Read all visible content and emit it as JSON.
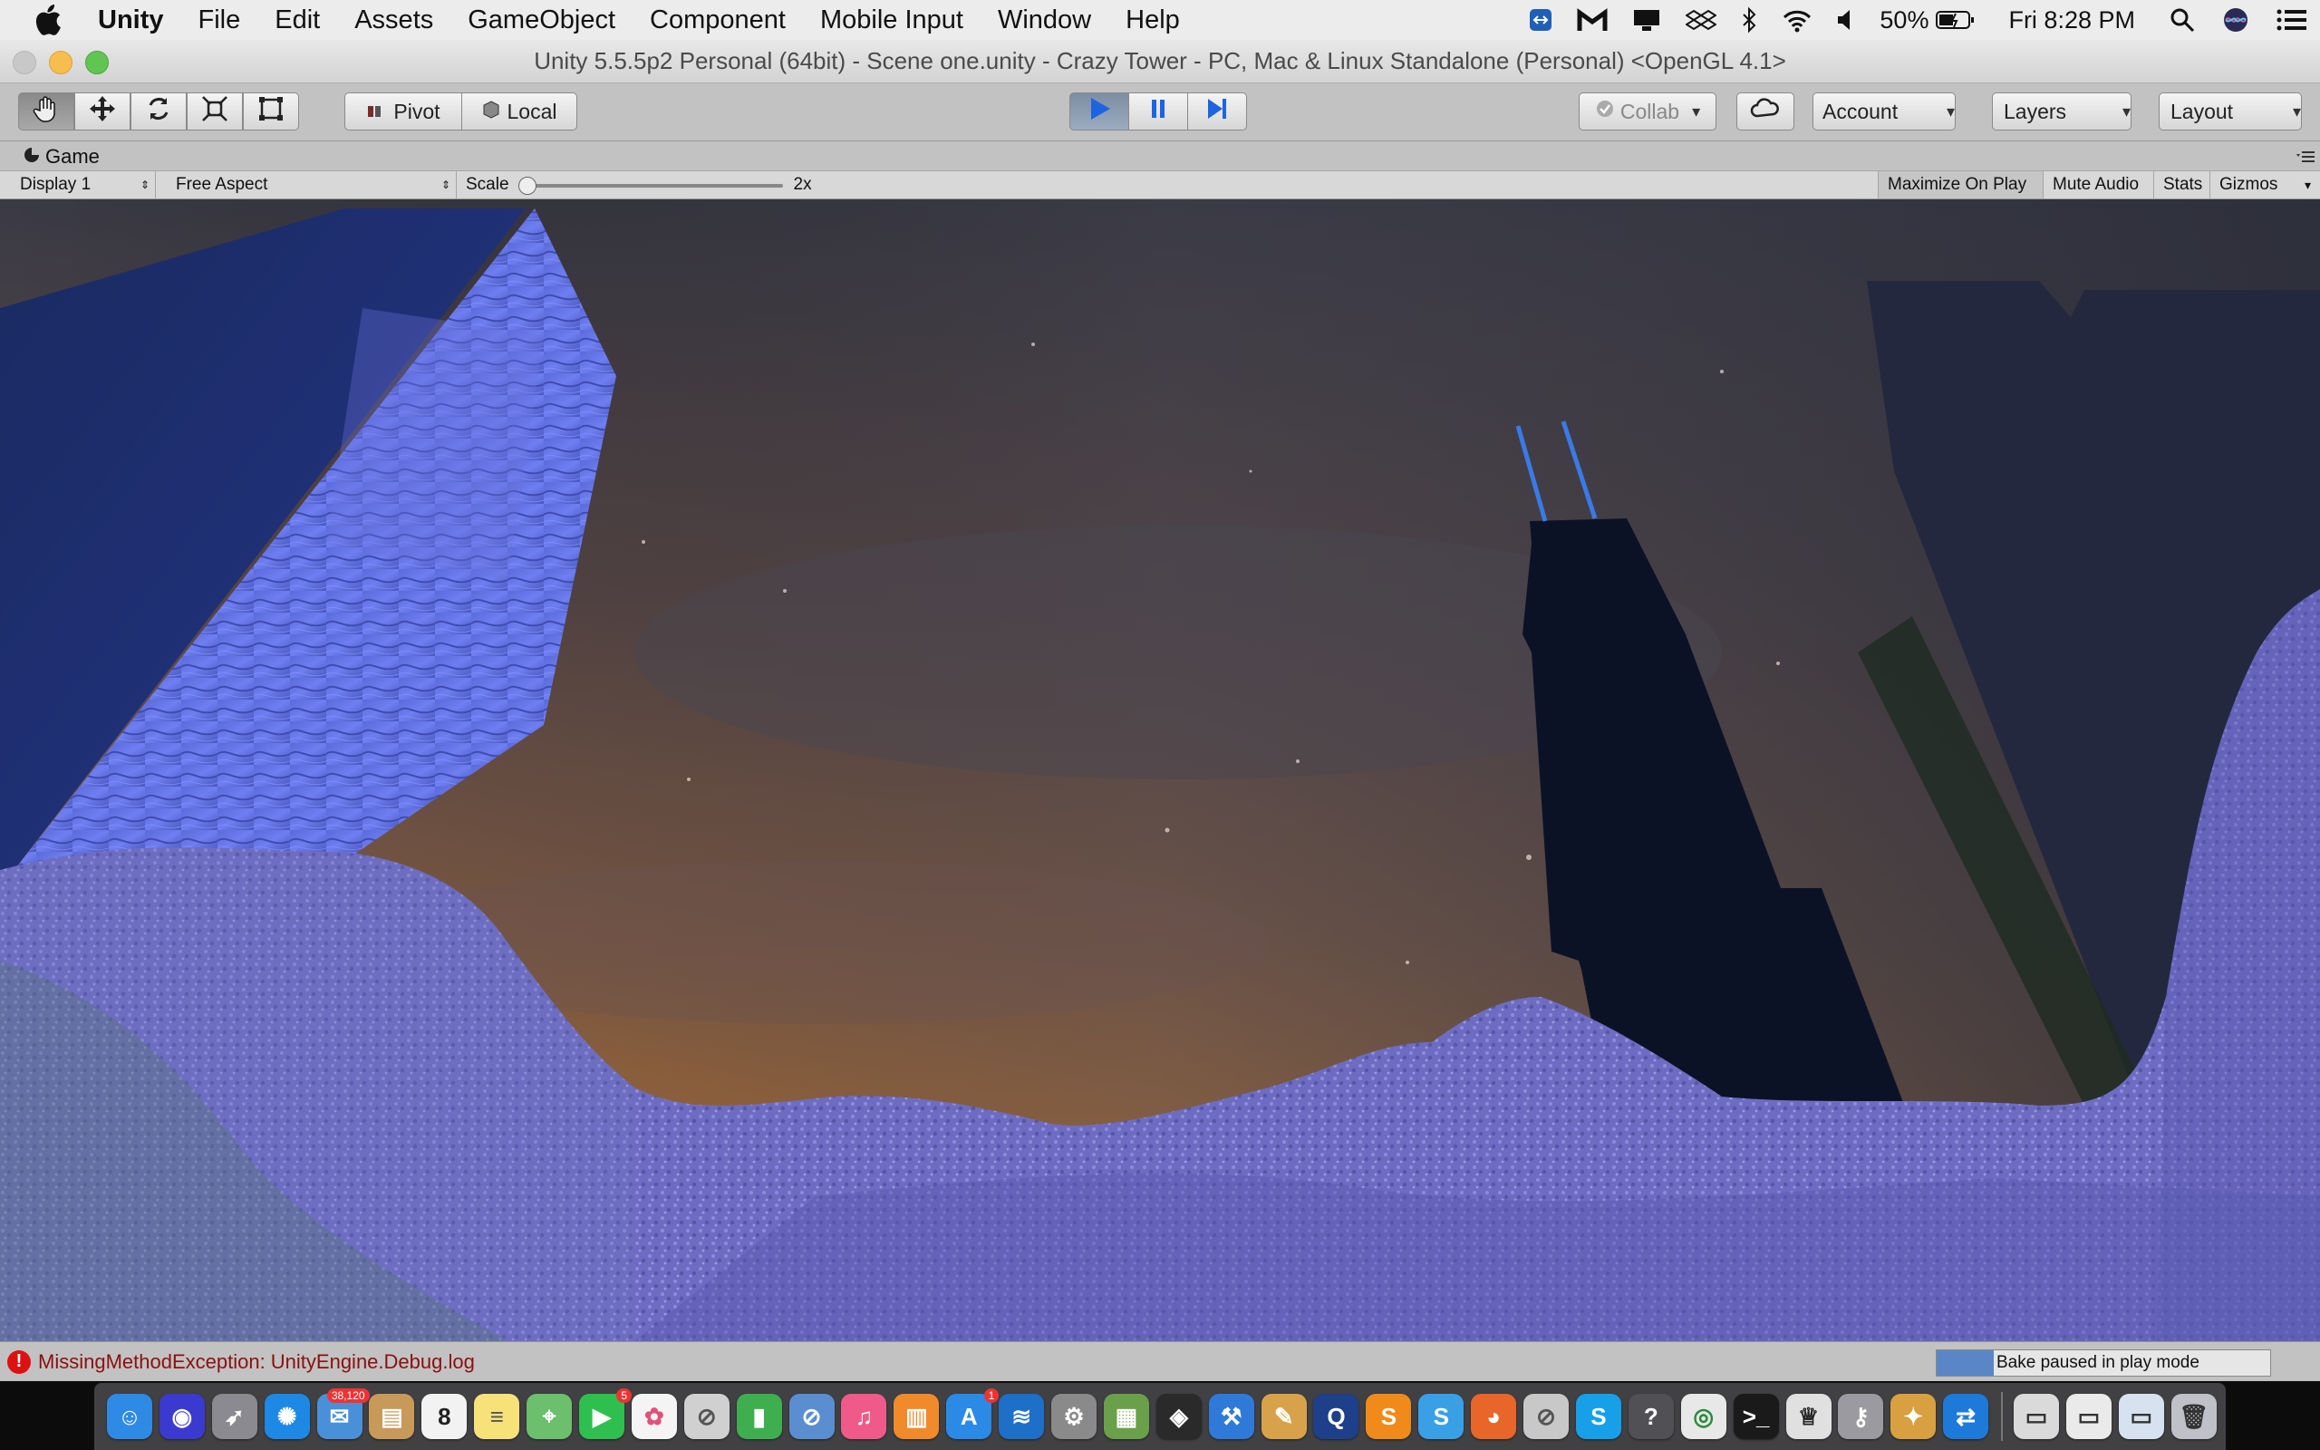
{
  "menubar": {
    "app_name": "Unity",
    "items": [
      "File",
      "Edit",
      "Assets",
      "GameObject",
      "Component",
      "Mobile Input",
      "Window",
      "Help"
    ],
    "battery": "50%",
    "clock": "Fri 8:28 PM",
    "status_icons": [
      "teamviewer-icon",
      "malwarebytes-icon",
      "display-icon",
      "dropbox-icon",
      "bluetooth-icon",
      "wifi-icon",
      "volume-icon",
      "battery-icon",
      "spotlight-icon",
      "siri-icon",
      "notification-center-icon"
    ]
  },
  "window": {
    "title": "Unity 5.5.5p2 Personal (64bit) - Scene one.unity - Crazy Tower - PC, Mac & Linux Standalone (Personal) <OpenGL 4.1>"
  },
  "toolbar": {
    "tools": [
      "hand-tool-icon",
      "move-tool-icon",
      "rotate-tool-icon",
      "scale-tool-icon",
      "rect-tool-icon"
    ],
    "pivot_label": "Pivot",
    "local_label": "Local",
    "collab_label": "Collab",
    "account_label": "Account",
    "layers_label": "Layers",
    "layout_label": "Layout"
  },
  "game_view": {
    "tab_label": "Game",
    "display": "Display 1",
    "aspect": "Free Aspect",
    "scale_label": "Scale",
    "scale_value": "2x",
    "maximize_on_play": "Maximize On Play",
    "mute_audio": "Mute Audio",
    "stats": "Stats",
    "gizmos": "Gizmos"
  },
  "statusbar": {
    "error_message": "MissingMethodException: UnityEngine.Debug.log",
    "progress_label": "Bake paused in play mode",
    "progress_fraction": 0.17
  },
  "dock": {
    "items": [
      {
        "name": "finder-icon",
        "color": "#2f8ae6",
        "glyph": "☺"
      },
      {
        "name": "siri-icon",
        "color": "#3a3ad0",
        "glyph": "◉"
      },
      {
        "name": "launchpad-icon",
        "color": "#8a8a90",
        "glyph": "➶"
      },
      {
        "name": "safari-icon",
        "color": "#1e88e5",
        "glyph": "✺"
      },
      {
        "name": "mail-icon",
        "color": "#4a90d9",
        "glyph": "✉",
        "badge": "38,120"
      },
      {
        "name": "contacts-icon",
        "color": "#c89a5a",
        "glyph": "▤"
      },
      {
        "name": "calendar-icon",
        "color": "#f2f2f2",
        "glyph": "8",
        "text_color": "#222"
      },
      {
        "name": "notes-icon",
        "color": "#f7e27a",
        "glyph": "≡",
        "text_color": "#555"
      },
      {
        "name": "maps-icon",
        "color": "#6cbf6c",
        "glyph": "⌖"
      },
      {
        "name": "facetime-icon",
        "color": "#2fbf4f",
        "glyph": "▶",
        "badge": "5"
      },
      {
        "name": "photos-icon",
        "color": "#f4f4f4",
        "glyph": "✿",
        "text_color": "#e0507a"
      },
      {
        "name": "blocked-app-icon",
        "color": "#d0d0d0",
        "glyph": "⊘",
        "text_color": "#555"
      },
      {
        "name": "numbers-icon",
        "color": "#3fae4f",
        "glyph": "▮"
      },
      {
        "name": "blocked-app-2-icon",
        "color": "#5a8ed0",
        "glyph": "⊘"
      },
      {
        "name": "itunes-icon",
        "color": "#f05a8a",
        "glyph": "♫"
      },
      {
        "name": "ibooks-icon",
        "color": "#f08a2a",
        "glyph": "▥"
      },
      {
        "name": "app-store-icon",
        "color": "#2a8ae6",
        "glyph": "A",
        "badge": "1"
      },
      {
        "name": "xcode-cloud-icon",
        "color": "#1e6fc8",
        "glyph": "≋"
      },
      {
        "name": "system-preferences-icon",
        "color": "#8a8a8a",
        "glyph": "⚙"
      },
      {
        "name": "minecraft-icon",
        "color": "#6aa04a",
        "glyph": "▦"
      },
      {
        "name": "unity-icon",
        "color": "#2a2a2a",
        "glyph": "◈"
      },
      {
        "name": "xcode-icon",
        "color": "#2f7ad8",
        "glyph": "⚒"
      },
      {
        "name": "instruments-icon",
        "color": "#d8a24a",
        "glyph": "✎"
      },
      {
        "name": "quicktime-icon",
        "color": "#1e3f8a",
        "glyph": "Q"
      },
      {
        "name": "sublime-text-icon",
        "color": "#f08a1a",
        "glyph": "S"
      },
      {
        "name": "sketch-icon",
        "color": "#3aa0e6",
        "glyph": "S"
      },
      {
        "name": "firefox-icon",
        "color": "#e8662a",
        "glyph": "◕"
      },
      {
        "name": "blocked-app-3-icon",
        "color": "#c8c8c8",
        "glyph": "⊘",
        "text_color": "#555"
      },
      {
        "name": "skype-icon",
        "color": "#17a0e8",
        "glyph": "S"
      },
      {
        "name": "help-icon",
        "color": "#505055",
        "glyph": "?"
      },
      {
        "name": "chrome-icon",
        "color": "#e8e8e8",
        "glyph": "◎",
        "text_color": "#2a8a3a"
      },
      {
        "name": "terminal-icon",
        "color": "#1a1a1a",
        "glyph": ">_"
      },
      {
        "name": "audio-midi-icon",
        "color": "#e0e0e0",
        "glyph": "♕",
        "text_color": "#222"
      },
      {
        "name": "keychain-icon",
        "color": "#9a9aa0",
        "glyph": "⚷"
      },
      {
        "name": "preview-icon",
        "color": "#d8a040",
        "glyph": "✦"
      },
      {
        "name": "teamviewer-icon",
        "color": "#1e7ad8",
        "glyph": "⇄"
      },
      {
        "name": "downloads-stack-icon",
        "color": "#dadada",
        "glyph": "▭",
        "text_color": "#333"
      },
      {
        "name": "documents-stack-icon",
        "color": "#eaeaea",
        "glyph": "▭",
        "text_color": "#333"
      },
      {
        "name": "desktop-stack-icon",
        "color": "#d6e2f0",
        "glyph": "▭",
        "text_color": "#333"
      },
      {
        "name": "trash-icon",
        "color": "#c0c0c8",
        "glyph": "🗑",
        "text_color": "#333"
      }
    ]
  }
}
